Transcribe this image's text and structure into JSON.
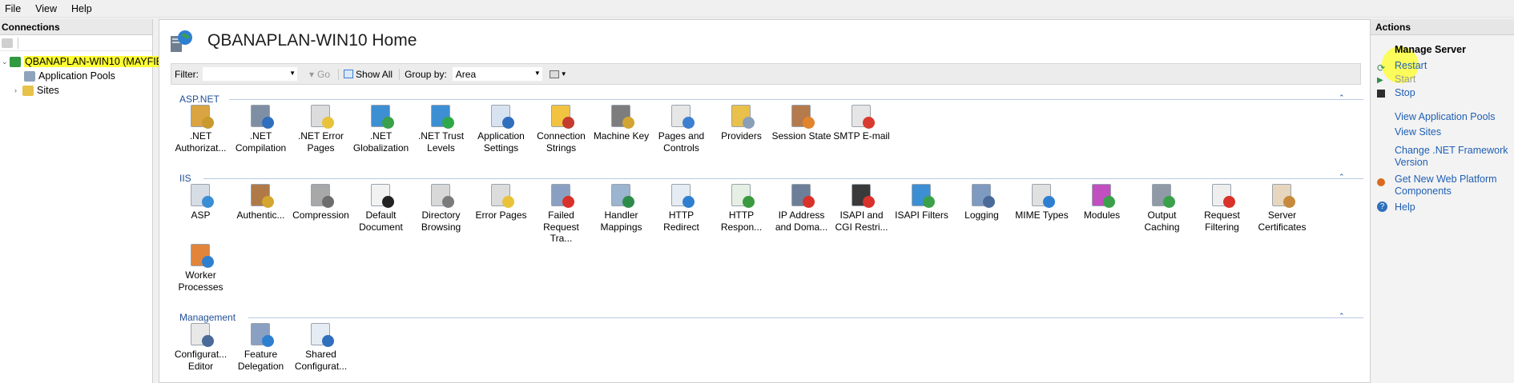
{
  "menu": [
    "File",
    "View",
    "Help"
  ],
  "connections": {
    "header": "Connections",
    "tree": {
      "server": "QBANAPLAN-WIN10 (MAYFIE",
      "app_pools": "Application Pools",
      "sites": "Sites"
    }
  },
  "content": {
    "title": "QBANAPLAN-WIN10 Home",
    "filter_label": "Filter:",
    "go_label": "Go",
    "show_all_label": "Show All",
    "group_by_label": "Group by:",
    "group_by_value": "Area",
    "sections": [
      {
        "name": "ASP.NET",
        "items": [
          {
            "label": ".NET Authorizat...",
            "icon": "net-authorization-icon",
            "color": "#d9a441",
            "accent": "#c99a2e"
          },
          {
            "label": ".NET Compilation",
            "icon": "net-compilation-icon",
            "color": "#7f8fa3",
            "accent": "#2f6fbd"
          },
          {
            "label": ".NET Error Pages",
            "icon": "net-error-pages-icon",
            "color": "#dcdcdc",
            "accent": "#e8c33a"
          },
          {
            "label": ".NET Globalization",
            "icon": "net-globalization-icon",
            "color": "#3d8fd3",
            "accent": "#3aa14a"
          },
          {
            "label": ".NET Trust Levels",
            "icon": "net-trust-levels-icon",
            "color": "#3d8fd3",
            "accent": "#2fa84a"
          },
          {
            "label": "Application Settings",
            "icon": "application-settings-icon",
            "color": "#d8e3f1",
            "accent": "#2f6fbd"
          },
          {
            "label": "Connection Strings",
            "icon": "connection-strings-icon",
            "color": "#f1c341",
            "accent": "#c43b2f"
          },
          {
            "label": "Machine Key",
            "icon": "machine-key-icon",
            "color": "#7d7d7d",
            "accent": "#d2a532"
          },
          {
            "label": "Pages and Controls",
            "icon": "pages-and-controls-icon",
            "color": "#e6e6e6",
            "accent": "#3c7fd0"
          },
          {
            "label": "Providers",
            "icon": "providers-icon",
            "color": "#e9c04a",
            "accent": "#8aa0b8"
          },
          {
            "label": "Session State",
            "icon": "session-state-icon",
            "color": "#b57a4c",
            "accent": "#e2842c"
          },
          {
            "label": "SMTP E-mail",
            "icon": "smtp-email-icon",
            "color": "#e5e5e5",
            "accent": "#d93a2f"
          }
        ]
      },
      {
        "name": "IIS",
        "items": [
          {
            "label": "ASP",
            "icon": "asp-icon",
            "color": "#d7dde4",
            "accent": "#3a8ed4"
          },
          {
            "label": "Authentic...",
            "icon": "authentication-icon",
            "color": "#b07a48",
            "accent": "#d3a62f"
          },
          {
            "label": "Compression",
            "icon": "compression-icon",
            "color": "#a8a8a8",
            "accent": "#6d6d6d"
          },
          {
            "label": "Default Document",
            "icon": "default-document-icon",
            "color": "#f2f2f2",
            "accent": "#222222"
          },
          {
            "label": "Directory Browsing",
            "icon": "directory-browsing-icon",
            "color": "#d8d8d8",
            "accent": "#7b7b7b"
          },
          {
            "label": "Error Pages",
            "icon": "error-pages-icon",
            "color": "#dcdcdc",
            "accent": "#e8c33a"
          },
          {
            "label": "Failed Request Tra...",
            "icon": "failed-request-tracing-icon",
            "color": "#8aa0c2",
            "accent": "#d8322a"
          },
          {
            "label": "Handler Mappings",
            "icon": "handler-mappings-icon",
            "color": "#9bb4cf",
            "accent": "#2e8c4a"
          },
          {
            "label": "HTTP Redirect",
            "icon": "http-redirect-icon",
            "color": "#e6ecf3",
            "accent": "#2f7fd1"
          },
          {
            "label": "HTTP Respon...",
            "icon": "http-response-headers-icon",
            "color": "#e6efe4",
            "accent": "#3a9a3e"
          },
          {
            "label": "IP Address and Doma...",
            "icon": "ip-address-restrictions-icon",
            "color": "#6d7f98",
            "accent": "#d8322a"
          },
          {
            "label": "ISAPI and CGI Restri...",
            "icon": "isapi-cgi-restrictions-icon",
            "color": "#3a3a3a",
            "accent": "#d8322a"
          },
          {
            "label": "ISAPI Filters",
            "icon": "isapi-filters-icon",
            "color": "#3d8fd3",
            "accent": "#3aa14a"
          },
          {
            "label": "Logging",
            "icon": "logging-icon",
            "color": "#7f9ac0",
            "accent": "#4a6a9a"
          },
          {
            "label": "MIME Types",
            "icon": "mime-types-icon",
            "color": "#e0e0e0",
            "accent": "#2f7fd1"
          },
          {
            "label": "Modules",
            "icon": "modules-icon",
            "color": "#c24fc0",
            "accent": "#3aa14a"
          },
          {
            "label": "Output Caching",
            "icon": "output-caching-icon",
            "color": "#8f9aa6",
            "accent": "#3aa14a"
          },
          {
            "label": "Request Filtering",
            "icon": "request-filtering-icon",
            "color": "#eeeeee",
            "accent": "#d8322a"
          },
          {
            "label": "Server Certificates",
            "icon": "server-certificates-icon",
            "color": "#e6d6bd",
            "accent": "#c78a3d"
          },
          {
            "label": "Worker Processes",
            "icon": "worker-processes-icon",
            "color": "#e2843a",
            "accent": "#2f7fd1"
          }
        ]
      },
      {
        "name": "Management",
        "items": [
          {
            "label": "Configurat... Editor",
            "icon": "configuration-editor-icon",
            "color": "#e8e8e8",
            "accent": "#4a6a9a"
          },
          {
            "label": "Feature Delegation",
            "icon": "feature-delegation-icon",
            "color": "#8aa0c2",
            "accent": "#2f7fd1"
          },
          {
            "label": "Shared Configurat...",
            "icon": "shared-configuration-icon",
            "color": "#e6ecf3",
            "accent": "#2f6fbd"
          }
        ]
      }
    ]
  },
  "actions": {
    "header": "Actions",
    "group_title": "Manage Server",
    "restart": "Restart",
    "start": "Start",
    "stop": "Stop",
    "view_app_pools": "View Application Pools",
    "view_sites": "View Sites",
    "change_net": "Change .NET Framework Version",
    "get_new": "Get New Web Platform Components",
    "help": "Help"
  },
  "colors": {
    "link": "#1f5fb4",
    "section": "#1f4e97",
    "highlight": "#ffff33"
  }
}
